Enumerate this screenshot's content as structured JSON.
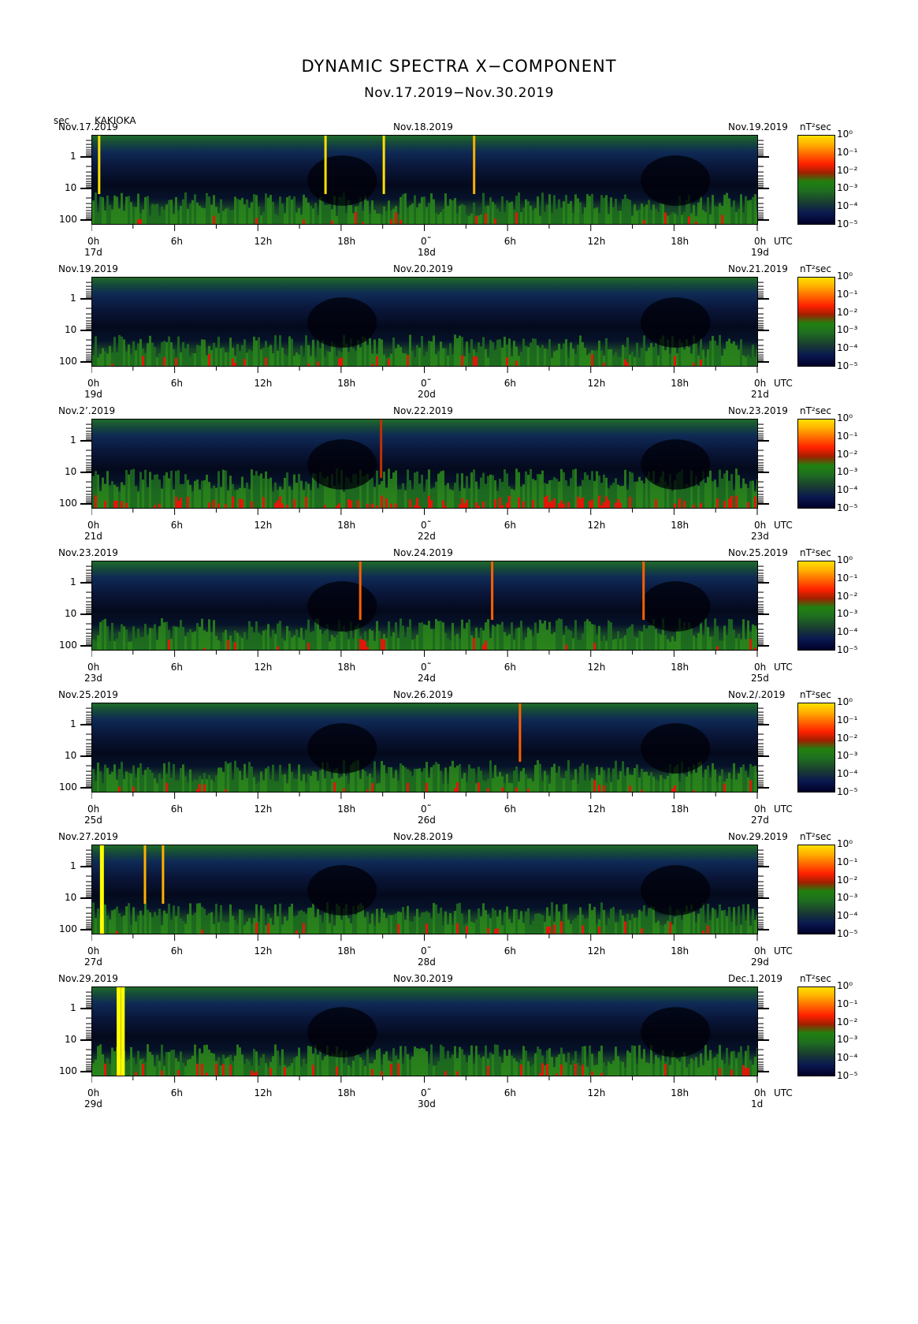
{
  "title": "DYNAMIC SPECTRA X−COMPONENT",
  "subtitle": "Nov.17.2019−Nov.30.2019",
  "header": {
    "unit_left": "sec",
    "station": "KAKIOKA"
  },
  "colorbar": {
    "unit": "nT²sec",
    "ticks": [
      "10⁰",
      "10⁻¹",
      "10⁻²",
      "10⁻³",
      "10⁻⁴",
      "10⁻⁵"
    ],
    "range": [
      1e-05,
      1
    ]
  },
  "x_ticks": [
    "0h",
    "6h",
    "12h",
    "18h",
    "0˜",
    "6h",
    "12h",
    "18h",
    "0h"
  ],
  "utc_label": "UTC",
  "y_ticks": [
    "1",
    "10",
    "100"
  ],
  "chart_data": {
    "type": "heatmap",
    "title": "DYNAMIC SPECTRA X−COMPONENT",
    "subtitle": "Nov.17.2019−Nov.30.2019",
    "ylabel": "sec",
    "y_scale": "log",
    "y_ticks": [
      1,
      10,
      100
    ],
    "x_ticks": [
      "0h",
      "6h",
      "12h",
      "18h",
      "0h",
      "6h",
      "12h",
      "18h",
      "0h"
    ],
    "colorbar_unit": "nT²sec",
    "colorbar_range": [
      1e-05,
      1
    ],
    "panels": [
      {
        "left_date": "Nov.17.2019",
        "mid_date": "Nov.18.2019",
        "right_date": "Nov.19.2019",
        "day_labels": [
          "17d",
          "18d",
          "19d"
        ],
        "spikes_hours": [
          0.5,
          16.8,
          21.0,
          27.5
        ],
        "spike_colors": [
          "#ffdf00",
          "#ffdf00",
          "#ffdf00",
          "#ffb000"
        ]
      },
      {
        "left_date": "Nov.19.2019",
        "mid_date": "Nov.20.2019",
        "right_date": "Nov.21.2019",
        "day_labels": [
          "19d",
          "20d",
          "21d"
        ],
        "spikes_hours": [],
        "spike_colors": []
      },
      {
        "left_date": "Nov.2’.2019",
        "mid_date": "Nov.22.2019",
        "right_date": "Nov.23.2019",
        "day_labels": [
          "21d",
          "22d",
          "23d"
        ],
        "spikes_hours": [
          20.8
        ],
        "spike_colors": [
          "#c03000"
        ]
      },
      {
        "left_date": "Nov.23.2019",
        "mid_date": "Nov.24.2019",
        "right_date": "Nov.25.2019",
        "day_labels": [
          "23d",
          "24d",
          "25d"
        ],
        "spikes_hours": [
          19.3,
          28.8,
          39.7
        ],
        "spike_colors": [
          "#ff6000",
          "#ff6000",
          "#ff6000"
        ]
      },
      {
        "left_date": "Nov.25.2019",
        "mid_date": "Nov.26.2019",
        "right_date": "Nov.2/.2019",
        "day_labels": [
          "25d",
          "26d",
          "27d"
        ],
        "spikes_hours": [
          30.8
        ],
        "spike_colors": [
          "#ff6000"
        ]
      },
      {
        "left_date": "Nov.27.2019",
        "mid_date": "Nov.28.2019",
        "right_date": "Nov.29.2019",
        "day_labels": [
          "27d",
          "28d",
          "29d"
        ],
        "spikes_hours": [
          0.7,
          3.8,
          5.1
        ],
        "spike_colors": [
          "#ffff00",
          "#ffb000",
          "#ffb000"
        ]
      },
      {
        "left_date": "Nov.29.2019",
        "mid_date": "Nov.30.2019",
        "right_date": "Dec.1.2019",
        "day_labels": [
          "29d",
          "30d",
          "1d"
        ],
        "spikes_hours": [
          1.9,
          2.2
        ],
        "spike_colors": [
          "#ffff00",
          "#ffff00"
        ]
      }
    ]
  }
}
